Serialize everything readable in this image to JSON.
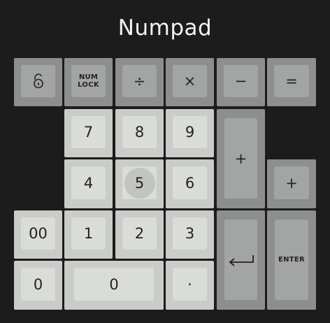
{
  "window": {
    "title": "Numpad"
  },
  "keys": {
    "lock": {
      "icon": "unlock-icon"
    },
    "numlock": {
      "line1": "NUM",
      "line2": "LOCK"
    },
    "divide": "÷",
    "multiply": "×",
    "minus": "−",
    "equals": "=",
    "seven": "7",
    "eight": "8",
    "nine": "9",
    "plus_tall": "+",
    "four": "4",
    "five": "5",
    "six": "6",
    "plus_small": "+",
    "double_zero": "00",
    "one": "1",
    "two": "2",
    "three": "3",
    "return": {
      "icon": "return-arrow-icon"
    },
    "enter": "ENTER",
    "zero_small": "0",
    "zero_wide": "0",
    "decimal": "·"
  },
  "colors": {
    "background": "#1c1c1c",
    "modifier_key": "#8d8f8e",
    "number_key": "#c9ccc8"
  }
}
